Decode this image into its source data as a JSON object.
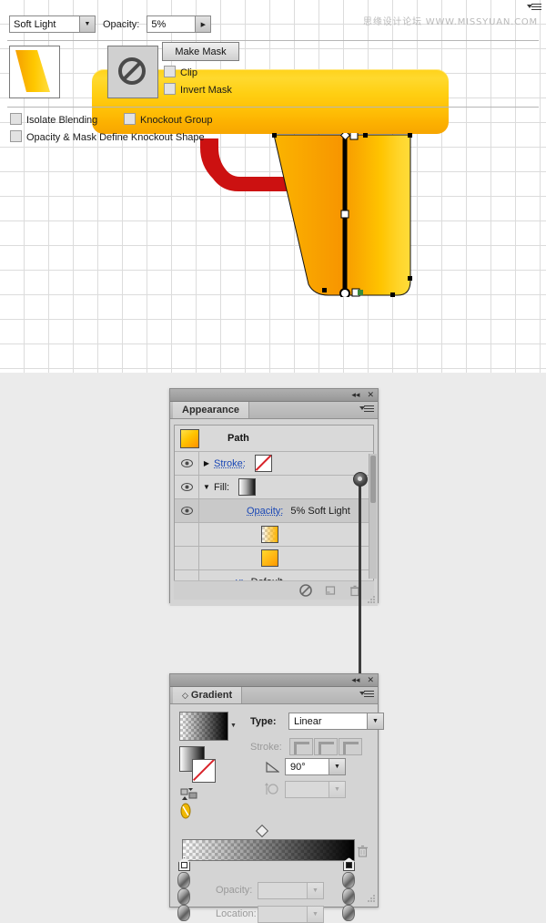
{
  "canvas": {
    "watermark": "思缘设计论坛 WWW.MISSYUAN.COM",
    "shapes": {
      "barrel": "barrel-shape",
      "trigger_guard": "trigger-guard-shape",
      "grip": "grip-shape-selected"
    },
    "colors": {
      "yellow_light": "#ffd92e",
      "yellow_dark": "#f7a600",
      "orange": "#f5a200",
      "red": "#cc1111",
      "grid_line": "#dcdcdc"
    }
  },
  "appearance_panel": {
    "title": "Appearance",
    "collapse_icon": "collapse-icon",
    "close_icon": "close-icon",
    "menu_icon": "panel-menu-icon",
    "object_label": "Path",
    "rows": [
      {
        "label": "Stroke:",
        "swatch": "none-swatch",
        "eye": "eye-icon",
        "triangle": "right"
      },
      {
        "label": "Fill:",
        "swatch": "gradient-swatch",
        "eye": "eye-icon",
        "triangle": "down"
      },
      {
        "label": "Opacity:",
        "value": "5% Soft Light",
        "eye": "eye-icon"
      },
      {
        "label": "",
        "swatch": "fade-swatch"
      },
      {
        "label": "",
        "swatch": "orange-swatch"
      },
      {
        "label": "y:",
        "value": "Default"
      }
    ],
    "footer_icons": [
      "no-effect-icon",
      "duplicate-icon",
      "delete-icon"
    ]
  },
  "transparency_popup": {
    "blend_mode": "Soft Light",
    "opacity_label": "Opacity:",
    "opacity_value": "5%",
    "make_mask_label": "Make Mask",
    "clip_label": "Clip",
    "invert_mask_label": "Invert Mask",
    "isolate_blending_label": "Isolate Blending",
    "knockout_group_label": "Knockout Group",
    "knockout_shape_label": "Opacity & Mask Define Knockout Shape",
    "menu_icon": "panel-menu-icon",
    "artwork_thumb": "artwork-thumbnail",
    "mask_thumb": "no-mask-thumbnail"
  },
  "gradient_panel": {
    "title": "Gradient",
    "collapse_icon": "collapse-icon",
    "close_icon": "close-icon",
    "menu_icon": "panel-menu-icon",
    "type_label": "Type:",
    "type_value": "Linear",
    "stroke_label": "Stroke:",
    "angle_label": "angle-icon",
    "angle_value": "90°",
    "aspect_label": "aspect-ratio-icon",
    "aspect_value": "",
    "opacity_label": "Opacity:",
    "opacity_value": "",
    "location_label": "Location:",
    "location_value": "",
    "gradient_stops": [
      {
        "position": 0,
        "color": "#ffffff",
        "opacity": 0
      },
      {
        "position": 100,
        "color": "#000000",
        "opacity": 100
      }
    ],
    "midpoint": 50,
    "delete_icon": "delete-stop-icon"
  }
}
